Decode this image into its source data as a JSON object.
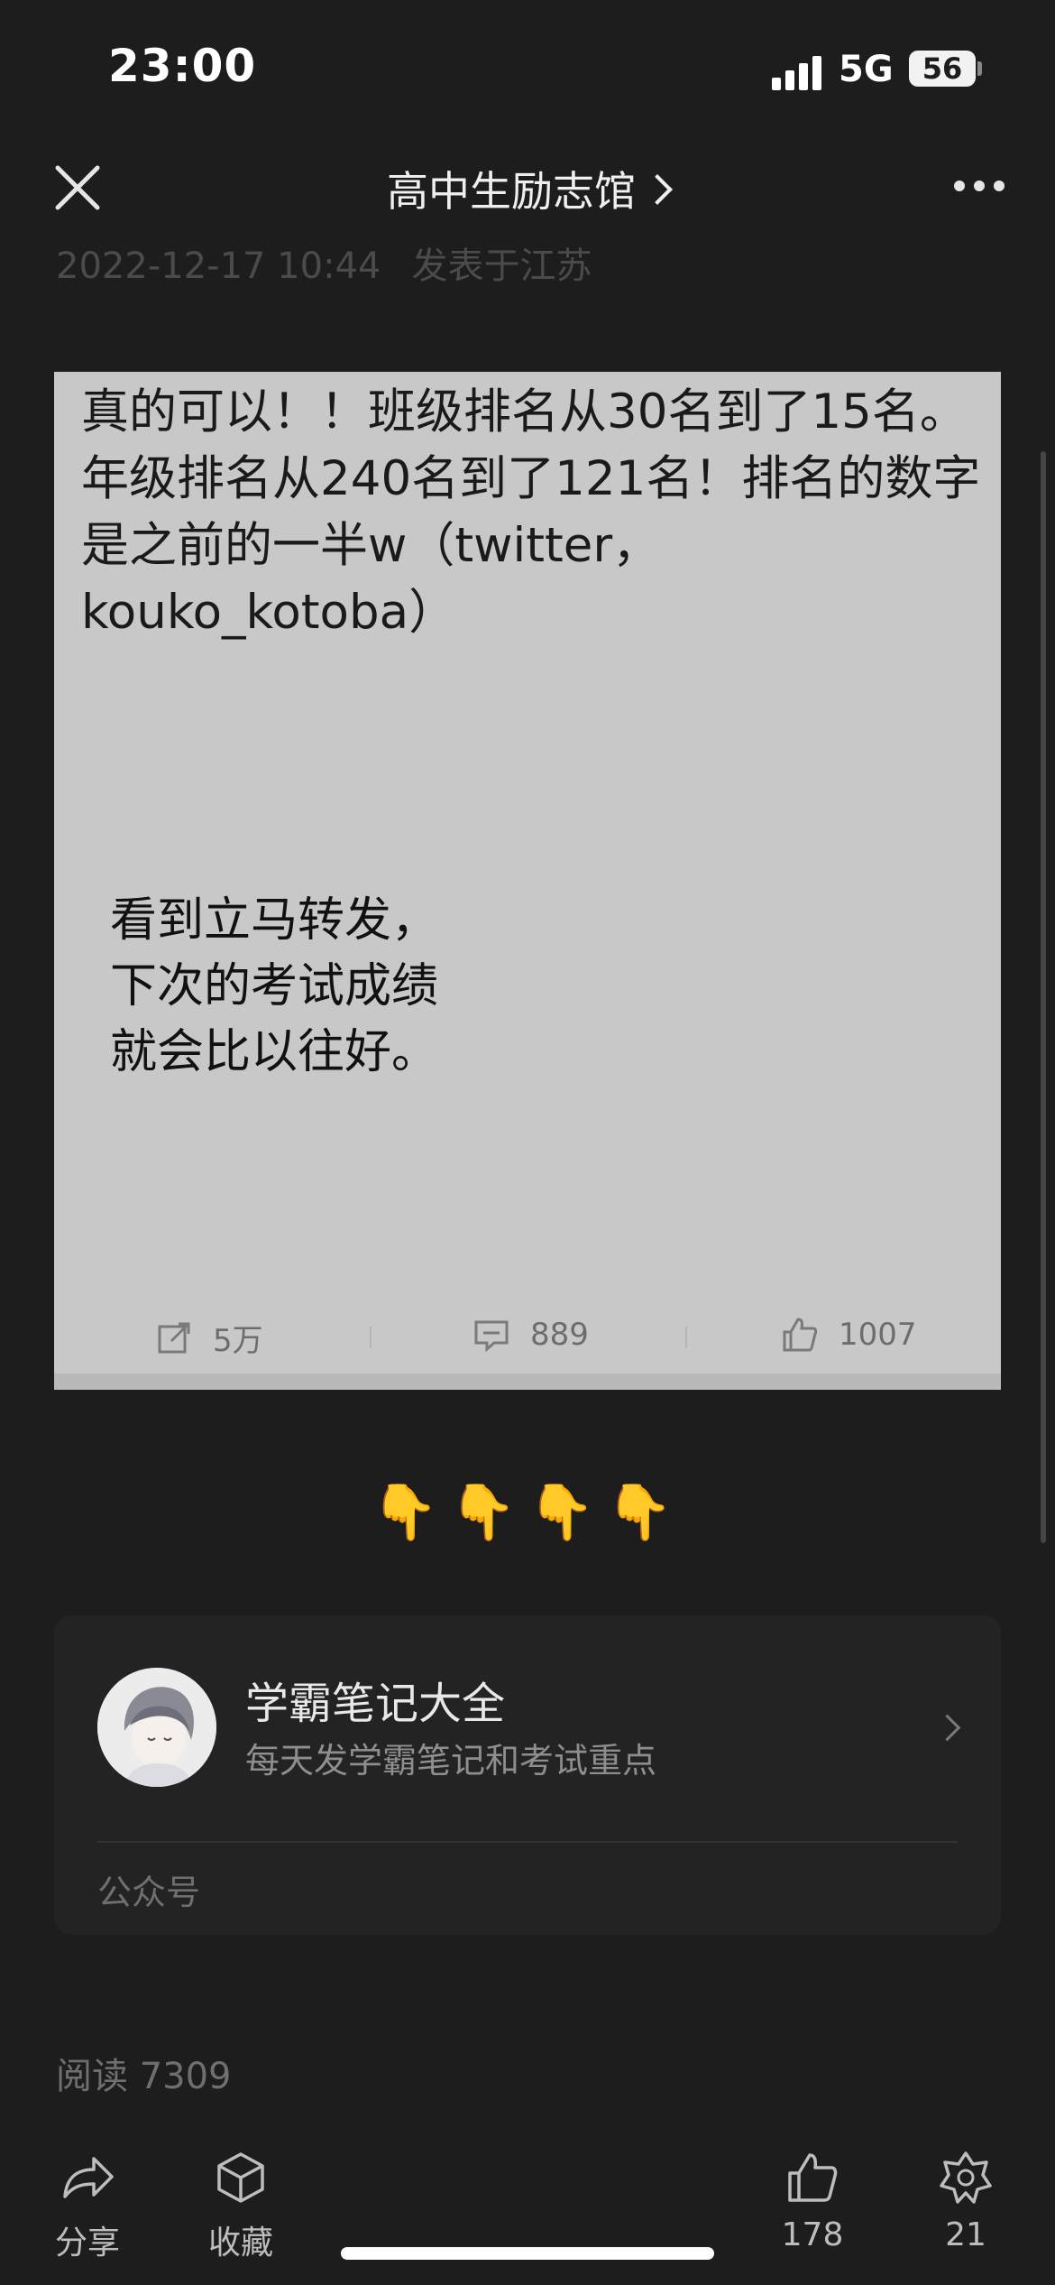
{
  "status_bar": {
    "time": "23:00",
    "network": "5G",
    "battery": "56"
  },
  "nav": {
    "title": "高中生励志馆",
    "close_icon": "close-icon",
    "more_icon": "more-icon"
  },
  "meta": {
    "date": "2022-12-17 10:44",
    "location": "发表于江苏"
  },
  "card": {
    "text": "真的可以！！班级排名从30名到了15名。年级排名从240名到了121名！排名的数字是之前的一半w（twitter，kouko_kotoba）",
    "quote_lines": [
      "看到立马转发，",
      "下次的考试成绩",
      "就会比以往好。"
    ],
    "stats": {
      "reposts": "5万",
      "comments": "889",
      "likes": "1007"
    }
  },
  "emoji_row": "👇👇👇👇",
  "account": {
    "name": "学霸笔记大全",
    "description": "每天发学霸笔记和考试重点",
    "type": "公众号"
  },
  "reads": "阅读 7309",
  "toolbar": {
    "share_label": "分享",
    "favorite_label": "收藏",
    "like_count": "178",
    "wow_count": "21"
  },
  "colors": {
    "background": "#1d1d1d",
    "card": "#c8c8c8",
    "accent_emoji": "#f2b838"
  }
}
